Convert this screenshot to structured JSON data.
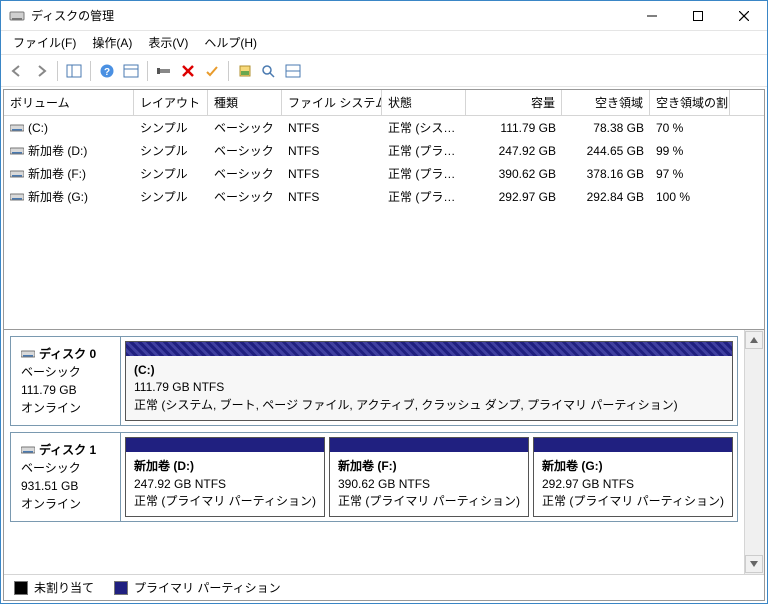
{
  "window": {
    "title": "ディスクの管理"
  },
  "menu": {
    "file": "ファイル(F)",
    "action": "操作(A)",
    "view": "表示(V)",
    "help": "ヘルプ(H)"
  },
  "columns": {
    "volume": "ボリューム",
    "layout": "レイアウト",
    "type": "種類",
    "filesystem": "ファイル システム",
    "status": "状態",
    "capacity": "容量",
    "free": "空き領域",
    "freepct": "空き領域の割…"
  },
  "volumes": [
    {
      "name": "(C:)",
      "layout": "シンプル",
      "type": "ベーシック",
      "fs": "NTFS",
      "status": "正常 (シス…",
      "capacity": "111.79 GB",
      "free": "78.38 GB",
      "freepct": "70 %"
    },
    {
      "name": "新加卷 (D:)",
      "layout": "シンプル",
      "type": "ベーシック",
      "fs": "NTFS",
      "status": "正常 (プラ…",
      "capacity": "247.92 GB",
      "free": "244.65 GB",
      "freepct": "99 %"
    },
    {
      "name": "新加卷 (F:)",
      "layout": "シンプル",
      "type": "ベーシック",
      "fs": "NTFS",
      "status": "正常 (プラ…",
      "capacity": "390.62 GB",
      "free": "378.16 GB",
      "freepct": "97 %"
    },
    {
      "name": "新加卷 (G:)",
      "layout": "シンプル",
      "type": "ベーシック",
      "fs": "NTFS",
      "status": "正常 (プラ…",
      "capacity": "292.97 GB",
      "free": "292.84 GB",
      "freepct": "100 %"
    }
  ],
  "disks": [
    {
      "name": "ディスク 0",
      "type": "ベーシック",
      "size": "111.79 GB",
      "status": "オンライン",
      "partitions": [
        {
          "name": "(C:)",
          "line2": "111.79 GB NTFS",
          "line3": "正常 (システム, ブート, ページ ファイル, アクティブ, クラッシュ ダンプ, プライマリ パーティション)",
          "hatched": true
        }
      ]
    },
    {
      "name": "ディスク 1",
      "type": "ベーシック",
      "size": "931.51 GB",
      "status": "オンライン",
      "partitions": [
        {
          "name": "新加卷  (D:)",
          "line2": "247.92 GB NTFS",
          "line3": "正常 (プライマリ パーティション)"
        },
        {
          "name": "新加卷  (F:)",
          "line2": "390.62 GB NTFS",
          "line3": "正常 (プライマリ パーティション)"
        },
        {
          "name": "新加卷  (G:)",
          "line2": "292.97 GB NTFS",
          "line3": "正常 (プライマリ パーティション)"
        }
      ]
    }
  ],
  "legend": {
    "unallocated": "未割り当て",
    "primary": "プライマリ パーティション"
  }
}
